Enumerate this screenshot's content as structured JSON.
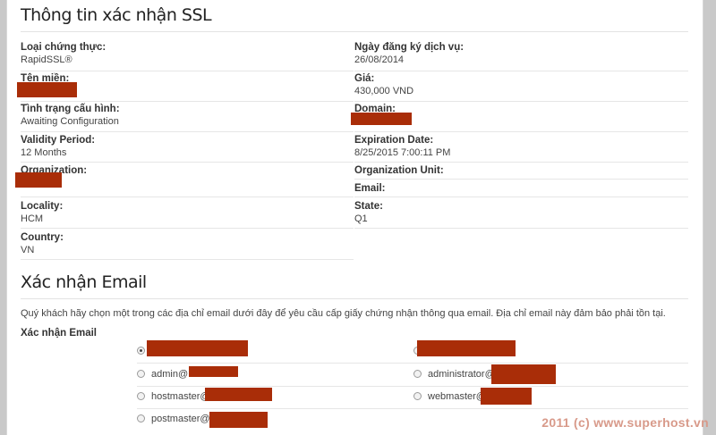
{
  "ssl_section": {
    "title": "Thông tin xác nhận SSL",
    "fields": [
      {
        "label": "Loại chứng thực:",
        "value": "RapidSSL®"
      },
      {
        "label": "Ngày đăng ký dịch vụ:",
        "value": "26/08/2014"
      },
      {
        "label": "Tên miền:",
        "value": ""
      },
      {
        "label": "Giá:",
        "value": "430,000 VND"
      },
      {
        "label": "Tình trạng cấu hình:",
        "value": "Awaiting Configuration"
      },
      {
        "label": "Domain:",
        "value": ""
      },
      {
        "label": "Validity Period:",
        "value": "12 Months"
      },
      {
        "label": "Expiration Date:",
        "value": "8/25/2015 7:00:11 PM"
      },
      {
        "label": "Organization:",
        "value": ""
      },
      {
        "label": "Organization Unit:",
        "value": ""
      },
      {
        "label": "Email:",
        "value": ""
      },
      {
        "label": "Locality:",
        "value": "HCM"
      },
      {
        "label": "State:",
        "value": "Q1"
      },
      {
        "label": "Country:",
        "value": "VN"
      }
    ]
  },
  "email_section": {
    "title": "Xác nhận Email",
    "intro": "Quý khách hãy chọn một trong các địa chỉ email dưới đây để yêu cầu cấp giấy chứng nhận thông qua email. Địa chỉ email này đảm bảo phải tồn tại.",
    "label": "Xác nhận Email",
    "options": [
      {
        "prefix": "",
        "selected": true
      },
      {
        "prefix": "",
        "selected": false
      },
      {
        "prefix": "admin@",
        "selected": false
      },
      {
        "prefix": "administrator@",
        "selected": false
      },
      {
        "prefix": "hostmaster@",
        "selected": false
      },
      {
        "prefix": "webmaster@",
        "selected": false
      },
      {
        "prefix": "postmaster@",
        "selected": false
      }
    ]
  },
  "colors": {
    "redaction": "#a92d08",
    "watermark": "#d89a8a"
  },
  "watermark": "2011 (c) www.superhost.vn"
}
